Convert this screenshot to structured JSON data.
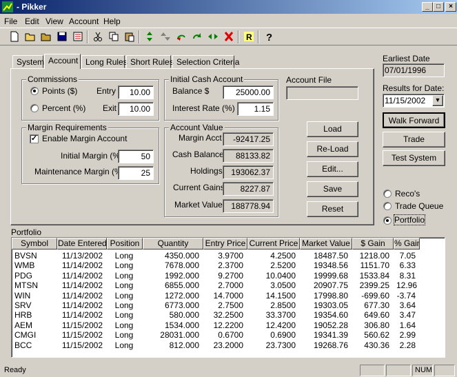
{
  "window": {
    "title": "- Pikker"
  },
  "menu": [
    "File",
    "Edit",
    "View",
    "Account",
    "Help"
  ],
  "tabs": [
    "System",
    "Account",
    "Long Rules",
    "Short Rules",
    "Selection Criteria"
  ],
  "commissions": {
    "label": "Commissions",
    "points_label": "Points ($)",
    "percent_label": "Percent (%)",
    "entry_label": "Entry",
    "exit_label": "Exit",
    "entry_value": "10.00",
    "exit_value": "10.00"
  },
  "initial_cash": {
    "label": "Initial Cash Account",
    "balance_label": "Balance  $",
    "balance_value": "25000.00",
    "interest_label": "Interest Rate (%)",
    "interest_value": "1.15"
  },
  "account_file": {
    "label": "Account File",
    "value": ""
  },
  "margin": {
    "label": "Margin Requirements",
    "enable_label": "Enable Margin Account",
    "initial_label": "Initial Margin (%)",
    "initial_value": "50",
    "maintenance_label": "Maintenance Margin (%)",
    "maintenance_value": "25"
  },
  "account_value": {
    "label": "Account Value",
    "margin_acct_label": "Margin Acct",
    "margin_acct_value": "-92417.25",
    "cash_balance_label": "Cash Balance",
    "cash_balance_value": "88133.82",
    "holdings_label": "Holdings",
    "holdings_value": "193062.37",
    "current_gains_label": "Current Gains",
    "current_gains_value": "8227.87",
    "market_value_label": "Market Value",
    "market_value_value": "188778.94"
  },
  "buttons": {
    "load": "Load",
    "reload": "Re-Load",
    "edit": "Edit...",
    "save": "Save",
    "reset": "Reset",
    "walk_forward": "Walk Forward",
    "trade": "Trade",
    "test_system": "Test System"
  },
  "sidebar": {
    "earliest_date_label": "Earliest Date",
    "earliest_date_value": "07/01/1996",
    "results_label": "Results for Date:",
    "results_value": "11/15/2002",
    "radio_recos": "Reco's",
    "radio_trade_queue": "Trade Queue",
    "radio_portfolio": "Portfolio"
  },
  "portfolio": {
    "label": "Portfolio",
    "columns": [
      "Symbol",
      "Date Entered",
      "Position",
      "Quantity",
      "Entry Price",
      "Current Price",
      "Market Value",
      "$ Gain",
      "% Gain"
    ],
    "rows": [
      [
        "BVSN",
        "11/13/2002",
        "Long",
        "4350.000",
        "3.9700",
        "4.2500",
        "18487.50",
        "1218.00",
        "7.05"
      ],
      [
        "WMB",
        "11/14/2002",
        "Long",
        "7678.000",
        "2.3700",
        "2.5200",
        "19348.56",
        "1151.70",
        "6.33"
      ],
      [
        "PDG",
        "11/14/2002",
        "Long",
        "1992.000",
        "9.2700",
        "10.0400",
        "19999.68",
        "1533.84",
        "8.31"
      ],
      [
        "MTSN",
        "11/14/2002",
        "Long",
        "6855.000",
        "2.7000",
        "3.0500",
        "20907.75",
        "2399.25",
        "12.96"
      ],
      [
        "WIN",
        "11/14/2002",
        "Long",
        "1272.000",
        "14.7000",
        "14.1500",
        "17998.80",
        "-699.60",
        "-3.74"
      ],
      [
        "SRV",
        "11/14/2002",
        "Long",
        "6773.000",
        "2.7500",
        "2.8500",
        "19303.05",
        "677.30",
        "3.64"
      ],
      [
        "HRB",
        "11/14/2002",
        "Long",
        "580.000",
        "32.2500",
        "33.3700",
        "19354.60",
        "649.60",
        "3.47"
      ],
      [
        "AEM",
        "11/15/2002",
        "Long",
        "1534.000",
        "12.2200",
        "12.4200",
        "19052.28",
        "306.80",
        "1.64"
      ],
      [
        "CMGI",
        "11/15/2002",
        "Long",
        "28031.000",
        "0.6700",
        "0.6900",
        "19341.39",
        "560.62",
        "2.99"
      ],
      [
        "BCC",
        "11/15/2002",
        "Long",
        "812.000",
        "23.2000",
        "23.7300",
        "19268.76",
        "430.36",
        "2.28"
      ]
    ]
  },
  "status": {
    "text": "Ready",
    "num": "NUM"
  }
}
